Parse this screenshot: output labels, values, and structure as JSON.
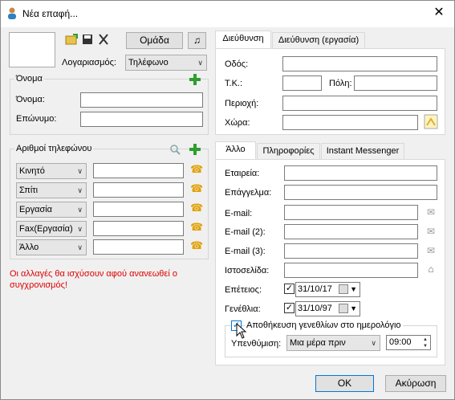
{
  "window": {
    "title": "Νέα επαφή..."
  },
  "left": {
    "group_button": "Ομάδα",
    "music_icon": "♫",
    "account_label": "Λογαριασμός:",
    "account_value": "Τηλέφωνο",
    "name_group": "Όνομα",
    "first_name_label": "Όνομα:",
    "last_name_label": "Επώνυμο:",
    "phones_group": "Αριθμοί τηλεφώνου",
    "phones": [
      {
        "type": "Κινητό"
      },
      {
        "type": "Σπίτι"
      },
      {
        "type": "Εργασία"
      },
      {
        "type": "Fax(Εργασία)"
      },
      {
        "type": "Άλλο"
      }
    ],
    "warning": "Οι αλλαγές θα ισχύσουν αφού ανανεωθεί ο συγχρονισμός!"
  },
  "address": {
    "tabs": [
      "Διεύθυνση",
      "Διεύθυνση (εργασία)"
    ],
    "street_label": "Οδός:",
    "zip_label": "Τ.Κ.:",
    "city_label": "Πόλη:",
    "region_label": "Περιοχή:",
    "country_label": "Χώρα:"
  },
  "other": {
    "tabs": [
      "Άλλο",
      "Πληροφορίες",
      "Instant Messenger"
    ],
    "company_label": "Εταιρεία:",
    "job_label": "Επάγγελμα:",
    "email_label": "E-mail:",
    "email2_label": "E-mail (2):",
    "email3_label": "E-mail (3):",
    "website_label": "Ιστοσελίδα:",
    "anniversary_label": "Επέτειος:",
    "anniversary_value": "31/10/17",
    "birthday_label": "Γενέθλια:",
    "birthday_value": "31/10/97",
    "save_birthday_label": "Αποθήκευση γενεθλίων στο ημερολόγιο",
    "reminder_label": "Υπενθύμιση:",
    "reminder_value": "Μια μέρα πριν",
    "time_value": "09:00"
  },
  "footer": {
    "ok": "OK",
    "cancel": "Ακύρωση"
  }
}
